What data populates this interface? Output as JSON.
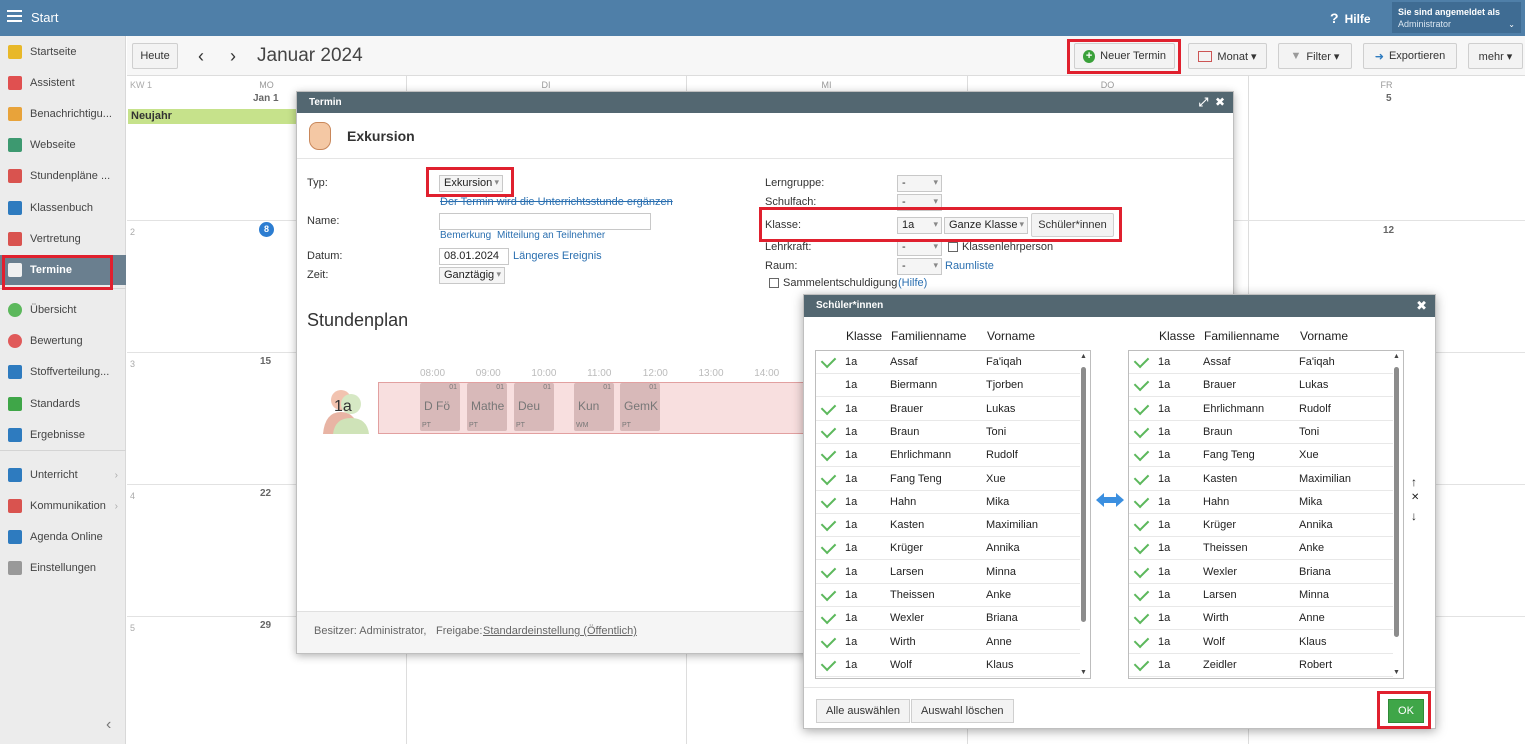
{
  "topbar": {
    "title": "Start",
    "help": "Hilfe",
    "login_label": "Sie sind angemeldet als",
    "login_user": "Administrator"
  },
  "sidebar": {
    "items": [
      {
        "label": "Startseite",
        "icon": "star-icon",
        "color": "#e8b829"
      },
      {
        "label": "Assistent",
        "icon": "wand-icon",
        "color": "#e05050"
      },
      {
        "label": "Benachrichtigu...",
        "icon": "mail-icon",
        "color": "#e8a33a"
      },
      {
        "label": "Webseite",
        "icon": "home-icon",
        "color": "#3d9970"
      },
      {
        "label": "Stundenpläne ...",
        "icon": "grid-icon",
        "color": "#d9534f"
      },
      {
        "label": "Klassenbuch",
        "icon": "book-icon",
        "color": "#2e7bbf"
      },
      {
        "label": "Vertretung",
        "icon": "person-icon",
        "color": "#d9534f"
      },
      {
        "label": "Termine",
        "icon": "calendar-icon",
        "color": "#f0f0f0"
      },
      {
        "label": "Übersicht",
        "icon": "check-circle-icon",
        "color": "#5cb85c"
      },
      {
        "label": "Bewertung",
        "icon": "rating-icon",
        "color": "#e05a5a"
      },
      {
        "label": "Stoffverteilung...",
        "icon": "briefcase-icon",
        "color": "#2e7bbf"
      },
      {
        "label": "Standards",
        "icon": "shield-icon",
        "color": "#3fa648"
      },
      {
        "label": "Ergebnisse",
        "icon": "bar-chart-icon",
        "color": "#2e7bbf"
      },
      {
        "label": "Unterricht",
        "icon": "board-icon",
        "color": "#2e7bbf"
      },
      {
        "label": "Kommunikation",
        "icon": "chat-icon",
        "color": "#d9534f"
      },
      {
        "label": "Agenda Online",
        "icon": "pen-icon",
        "color": "#2e7bbf"
      },
      {
        "label": "Einstellungen",
        "icon": "gear-icon",
        "color": "#999999"
      }
    ],
    "collapse_glyph": "‹",
    "arrow_glyph": "›"
  },
  "toolbar": {
    "today": "Heute",
    "prev": "‹",
    "next": "›",
    "month_title": "Januar 2024",
    "new_event": "Neuer Termin",
    "month_view": "Monat ▾",
    "filter": "Filter ▾",
    "export": "Exportieren",
    "more": "mehr ▾"
  },
  "calendar": {
    "week_label": "KW 1",
    "days": [
      "MO",
      "DI",
      "MI",
      "DO",
      "FR"
    ],
    "first_date": "Jan 1",
    "holiday": "Neujahr",
    "weeks": [
      "2",
      "3",
      "4",
      "5"
    ],
    "mon_dates": [
      "8",
      "15",
      "22",
      "29"
    ],
    "fri_dates": [
      "5",
      "12"
    ]
  },
  "termin": {
    "header": "Termin",
    "title": "Exkursion",
    "type_label": "Typ:",
    "type_value": "Exkursion",
    "type_hint": "Der Termin wird die Unterrichtsstunde ergänzen",
    "name_label": "Name:",
    "name_value": "",
    "remark_link": "Bemerkung",
    "notify_link": "Mitteilung an Teilnehmer",
    "date_label": "Datum:",
    "date_value": "08.01.2024",
    "longer_link": "Längeres Ereignis",
    "time_label": "Zeit:",
    "time_value": "Ganztägig",
    "lerngruppe_label": "Lerngruppe:",
    "lerngruppe_value": "-",
    "schulfach_label": "Schulfach:",
    "schulfach_value": "-",
    "klasse_label": "Klasse:",
    "klasse_value": "1a",
    "klasse_scope": "Ganze Klasse",
    "students_button": "Schüler*innen",
    "lehrkraft_label": "Lehrkraft:",
    "lehrkraft_value": "-",
    "klassenlehr_label": "Klassenlehrperson",
    "raum_label": "Raum:",
    "raum_value": "-",
    "raumliste_link": "Raumliste",
    "sammel_label": "Sammelentschuldigung",
    "sammel_help": "(Hilfe)",
    "schedule_title": "Stundenplan",
    "class_label": "1a",
    "hours": [
      "08:00",
      "09:00",
      "10:00",
      "11:00",
      "12:00",
      "13:00",
      "14:00"
    ],
    "lessons": [
      {
        "subject": "D Fö",
        "num": "01",
        "room": "PT"
      },
      {
        "subject": "Mathe",
        "num": "01",
        "room": "PT"
      },
      {
        "subject": "Deu",
        "num": "01",
        "room": "PT"
      },
      {
        "subject": "Kun",
        "num": "01",
        "room": "WM"
      },
      {
        "subject": "GemK",
        "num": "01",
        "room": "PT"
      }
    ],
    "owner_label": "Besitzer: Administrator,",
    "share_label": "Freigabe:",
    "share_link": "Standardeinstellung (Öffentlich)"
  },
  "students_dialog": {
    "header": "Schüler*innen",
    "columns": [
      "Klasse",
      "Familienname",
      "Vorname"
    ],
    "left": [
      {
        "klasse": "1a",
        "last": "Assaf",
        "first": "Fa'iqah",
        "checked": true
      },
      {
        "klasse": "1a",
        "last": "Biermann",
        "first": "Tjorben",
        "checked": false
      },
      {
        "klasse": "1a",
        "last": "Brauer",
        "first": "Lukas",
        "checked": true
      },
      {
        "klasse": "1a",
        "last": "Braun",
        "first": "Toni",
        "checked": true
      },
      {
        "klasse": "1a",
        "last": "Ehrlichmann",
        "first": "Rudolf",
        "checked": true
      },
      {
        "klasse": "1a",
        "last": "Fang Teng",
        "first": "Xue",
        "checked": true
      },
      {
        "klasse": "1a",
        "last": "Hahn",
        "first": "Mika",
        "checked": true
      },
      {
        "klasse": "1a",
        "last": "Kasten",
        "first": "Maximilian",
        "checked": true
      },
      {
        "klasse": "1a",
        "last": "Krüger",
        "first": "Annika",
        "checked": true
      },
      {
        "klasse": "1a",
        "last": "Larsen",
        "first": "Minna",
        "checked": true
      },
      {
        "klasse": "1a",
        "last": "Theissen",
        "first": "Anke",
        "checked": true
      },
      {
        "klasse": "1a",
        "last": "Wexler",
        "first": "Briana",
        "checked": true
      },
      {
        "klasse": "1a",
        "last": "Wirth",
        "first": "Anne",
        "checked": true
      },
      {
        "klasse": "1a",
        "last": "Wolf",
        "first": "Klaus",
        "checked": true
      }
    ],
    "right": [
      {
        "klasse": "1a",
        "last": "Assaf",
        "first": "Fa'iqah"
      },
      {
        "klasse": "1a",
        "last": "Brauer",
        "first": "Lukas"
      },
      {
        "klasse": "1a",
        "last": "Ehrlichmann",
        "first": "Rudolf"
      },
      {
        "klasse": "1a",
        "last": "Braun",
        "first": "Toni"
      },
      {
        "klasse": "1a",
        "last": "Fang Teng",
        "first": "Xue"
      },
      {
        "klasse": "1a",
        "last": "Kasten",
        "first": "Maximilian"
      },
      {
        "klasse": "1a",
        "last": "Hahn",
        "first": "Mika"
      },
      {
        "klasse": "1a",
        "last": "Krüger",
        "first": "Annika"
      },
      {
        "klasse": "1a",
        "last": "Theissen",
        "first": "Anke"
      },
      {
        "klasse": "1a",
        "last": "Wexler",
        "first": "Briana"
      },
      {
        "klasse": "1a",
        "last": "Larsen",
        "first": "Minna"
      },
      {
        "klasse": "1a",
        "last": "Wirth",
        "first": "Anne"
      },
      {
        "klasse": "1a",
        "last": "Wolf",
        "first": "Klaus"
      },
      {
        "klasse": "1a",
        "last": "Zeidler",
        "first": "Robert"
      }
    ],
    "select_all": "Alle auswählen",
    "clear_selection": "Auswahl löschen",
    "ok": "OK",
    "move_up": "↑",
    "remove": "✕",
    "move_down": "↓"
  },
  "colors": {
    "topbar": "#4f7fa8",
    "highlight": "#e0202e",
    "holiday": "#c6e28b",
    "ok": "#3fa648",
    "dialog_header": "#536771"
  }
}
